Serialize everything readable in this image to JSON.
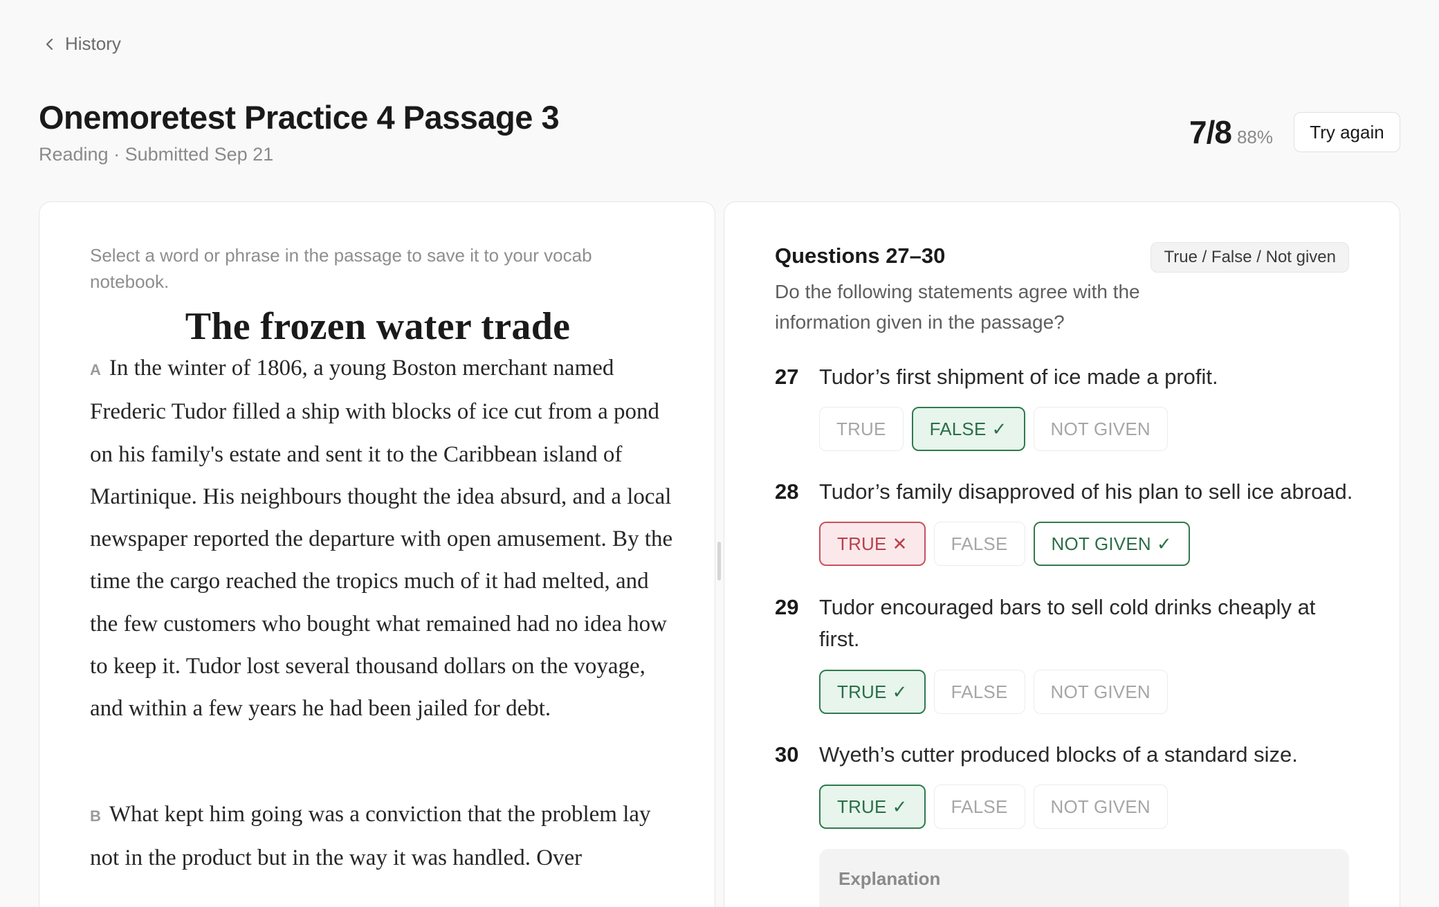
{
  "nav": {
    "back_label": "History"
  },
  "header": {
    "title": "Onemoretest Practice 4 Passage 3",
    "subtitle": "Reading · Submitted Sep 21",
    "score": "7/8",
    "percent": "88%",
    "try_again_label": "Try again"
  },
  "passage": {
    "hint": "Select a word or phrase in the passage to save it to your vocab notebook.",
    "title": "The frozen water trade",
    "paragraphs": [
      {
        "letter": "A",
        "text": "In the winter of 1806, a young Boston merchant named Frederic Tudor filled a ship with blocks of ice cut from a pond on his family's estate and sent it to the Caribbean island of Martinique. His neighbours thought the idea absurd, and a local newspaper reported the departure with open amusement. By the time the cargo reached the tropics much of it had melted, and the few customers who bought what remained had no idea how to keep it. Tudor lost several thousand dollars on the voyage, and within a few years he had been jailed for debt."
      },
      {
        "letter": "B",
        "text": "What kept him going was a conviction that the problem lay not in the product but in the way it was handled. Over"
      }
    ]
  },
  "questions": {
    "header": "Questions 27–30",
    "type_badge": "True / False / Not given",
    "instructions": "Do the following statements agree with the information given in the passage?",
    "items": [
      {
        "number": "27",
        "text": "Tudor’s first shipment of ice made a profit.",
        "options": [
          {
            "label": "TRUE",
            "mark": ""
          },
          {
            "label": "FALSE",
            "mark": "✓"
          },
          {
            "label": "NOT GIVEN",
            "mark": ""
          }
        ]
      },
      {
        "number": "28",
        "text": "Tudor’s family disapproved of his plan to sell ice abroad.",
        "options": [
          {
            "label": "TRUE",
            "mark": "✕"
          },
          {
            "label": "FALSE",
            "mark": ""
          },
          {
            "label": "NOT GIVEN",
            "mark": "✓"
          }
        ]
      },
      {
        "number": "29",
        "text": "Tudor encouraged bars to sell cold drinks cheaply at first.",
        "options": [
          {
            "label": "TRUE",
            "mark": "✓"
          },
          {
            "label": "FALSE",
            "mark": ""
          },
          {
            "label": "NOT GIVEN",
            "mark": ""
          }
        ]
      },
      {
        "number": "30",
        "text": "Wyeth’s cutter produced blocks of a standard size.",
        "options": [
          {
            "label": "TRUE",
            "mark": "✓"
          },
          {
            "label": "FALSE",
            "mark": ""
          },
          {
            "label": "NOT GIVEN",
            "mark": ""
          }
        ]
      }
    ],
    "explanation_label": "Explanation"
  },
  "colors": {
    "correct": "#2f7a4e",
    "correct_bg": "#e7f5ec",
    "wrong": "#c9505c",
    "wrong_bg": "#fbe8ea"
  },
  "icons": {
    "back": "chevron-left-icon",
    "correct": "check-icon",
    "wrong": "cross-icon"
  }
}
